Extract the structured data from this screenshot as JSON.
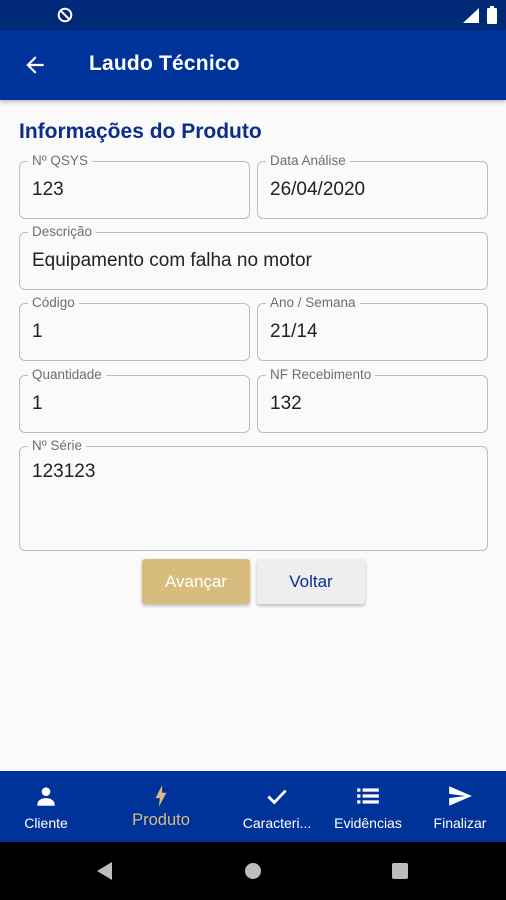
{
  "app_bar": {
    "title": "Laudo Técnico"
  },
  "form": {
    "section_title": "Informações do Produto",
    "fields": {
      "nqsys": {
        "label": "Nº QSYS",
        "value": "123"
      },
      "data_analise": {
        "label": "Data Análise",
        "value": "26/04/2020"
      },
      "descricao": {
        "label": "Descrição",
        "value": "Equipamento com falha no motor"
      },
      "codigo": {
        "label": "Código",
        "value": "1"
      },
      "ano_semana": {
        "label": "Ano / Semana",
        "value": "21/14"
      },
      "quantidade": {
        "label": "Quantidade",
        "value": "1"
      },
      "nf_recebimento": {
        "label": "NF Recebimento",
        "value": "132"
      },
      "nserie": {
        "label": "Nº Série",
        "value": "123123"
      }
    }
  },
  "buttons": {
    "advance": "Avançar",
    "back": "Voltar"
  },
  "bottom_nav": {
    "items": [
      {
        "label": "Cliente",
        "icon": "person-icon"
      },
      {
        "label": "Produto",
        "icon": "bolt-icon",
        "active": true
      },
      {
        "label": "Caracteri...",
        "icon": "check-icon"
      },
      {
        "label": "Evidências",
        "icon": "list-icon"
      },
      {
        "label": "Finalizar",
        "icon": "send-icon"
      }
    ]
  },
  "colors": {
    "primary": "#003399",
    "status_bar": "#002a78",
    "accent": "#d8bc7e",
    "section_title": "#0d2d8c"
  }
}
